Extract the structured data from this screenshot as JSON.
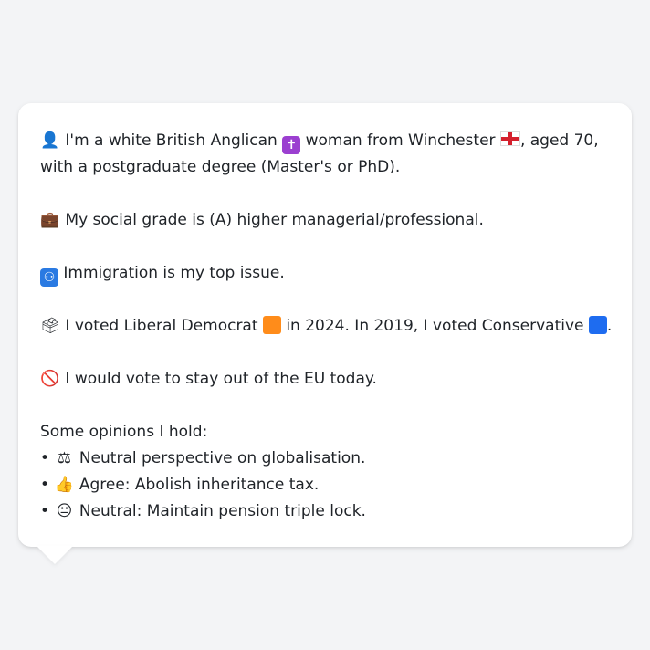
{
  "profile": {
    "intro": {
      "icon": "person-silhouette-icon",
      "text_before_religion": "I'm a white British Anglican",
      "religion_icon": "latin-cross-icon",
      "text_before_place": "woman from Winchester",
      "flag_icon": "england-flag-icon",
      "text_after_place": ", aged 70, with a postgraduate degree (Master's or PhD)."
    },
    "social_grade": {
      "icon": "briefcase-icon",
      "text": "My social grade is (A) higher managerial/professional."
    },
    "top_issue": {
      "icon": "passport-control-icon",
      "text": "Immigration is my top issue."
    },
    "vote": {
      "icon": "ballot-box-icon",
      "text_before_2024": "I voted Liberal Democrat",
      "party_2024_color": "#ff8c1a",
      "text_middle": "in 2024. In 2019, I voted Conservative",
      "party_2019_color": "#1e6cf0",
      "text_end": "."
    },
    "eu": {
      "icon": "no-entry-sign-icon",
      "text": "I would vote to stay out of the EU today."
    },
    "opinions": {
      "heading": "Some opinions I hold:",
      "items": [
        {
          "icon": "balance-scale-icon",
          "text": "Neutral perspective on globalisation."
        },
        {
          "icon": "thumbs-up-icon",
          "text": "Agree: Abolish inheritance tax."
        },
        {
          "icon": "neutral-face-icon",
          "text": "Neutral: Maintain pension triple lock."
        }
      ]
    }
  }
}
